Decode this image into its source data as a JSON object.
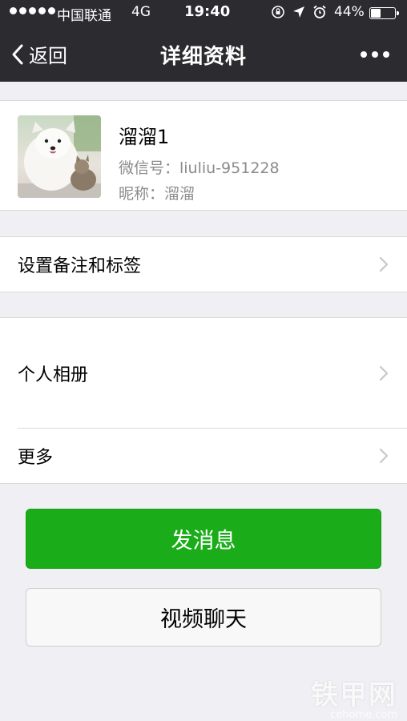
{
  "status_bar": {
    "carrier": "中国联通",
    "network": "4G",
    "time": "19:40",
    "battery": "44%",
    "battery_level": 0.44,
    "icons": [
      "signal-dots-icon",
      "orientation-lock-icon",
      "location-arrow-icon",
      "alarm-icon",
      "battery-icon"
    ]
  },
  "nav": {
    "back_label": "返回",
    "title": "详细资料",
    "more_icon": "more-dots-icon"
  },
  "profile": {
    "name": "溜溜1",
    "wechat_id": "微信号：liuliu-951228",
    "nickname": "昵称：溜溜"
  },
  "menu": {
    "remark_tags": "设置备注和标签",
    "album": "个人相册",
    "more": "更多"
  },
  "actions": {
    "send_message": "发消息",
    "video_chat": "视频聊天"
  },
  "watermark": {
    "text": "铁甲网",
    "url": "cehome.com"
  },
  "colors": {
    "nav_bg": "#2b2b30",
    "page_bg": "#efeff4",
    "primary_green": "#1aad19",
    "secondary_text": "#8b8b8b"
  }
}
